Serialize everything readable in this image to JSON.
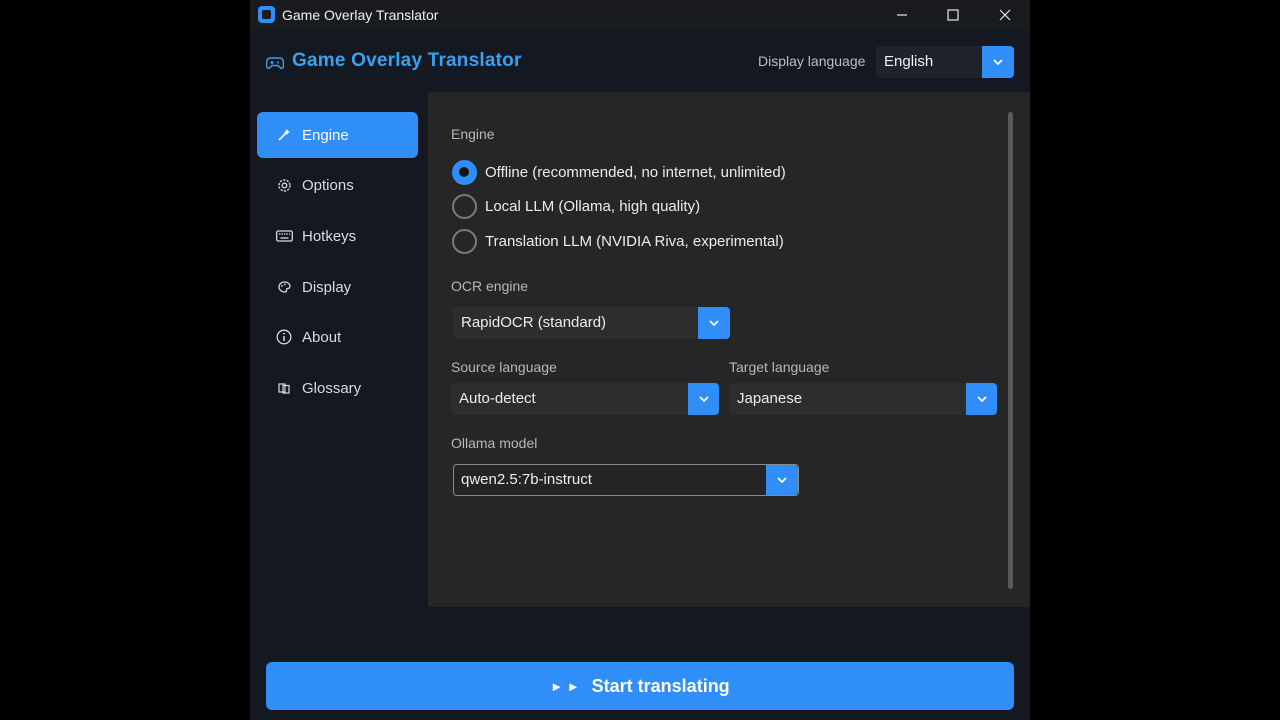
{
  "window": {
    "title": "Game Overlay Translator"
  },
  "header": {
    "app_title": "Game Overlay Translator",
    "display_language_label": "Display language",
    "display_language_value": "English"
  },
  "sidebar": {
    "items": [
      {
        "label": "Engine",
        "icon": "wand-icon",
        "active": true
      },
      {
        "label": "Options",
        "icon": "gear-icon",
        "active": false
      },
      {
        "label": "Hotkeys",
        "icon": "keyboard-icon",
        "active": false
      },
      {
        "label": "Display",
        "icon": "palette-icon",
        "active": false
      },
      {
        "label": "About",
        "icon": "info-icon",
        "active": false
      },
      {
        "label": "Glossary",
        "icon": "book-icon",
        "active": false
      }
    ]
  },
  "engine": {
    "section_label": "Engine",
    "options": [
      {
        "label": "Offline (recommended, no internet, unlimited)",
        "selected": true
      },
      {
        "label": "Local LLM (Ollama, high quality)",
        "selected": false
      },
      {
        "label": "Translation LLM (NVIDIA Riva, experimental)",
        "selected": false
      }
    ],
    "ocr_label": "OCR engine",
    "ocr_value": "RapidOCR (standard)",
    "source_label": "Source language",
    "source_value": "Auto-detect",
    "target_label": "Target language",
    "target_value": "Japanese",
    "ollama_label": "Ollama model",
    "ollama_value": "qwen2.5:7b-instruct"
  },
  "footer": {
    "start_icon": "► ►",
    "start_label": "Start translating"
  },
  "colors": {
    "accent": "#2f8ef7",
    "title_blue": "#3aa0f0",
    "panel_bg": "#262626",
    "app_bg": "#141820"
  }
}
